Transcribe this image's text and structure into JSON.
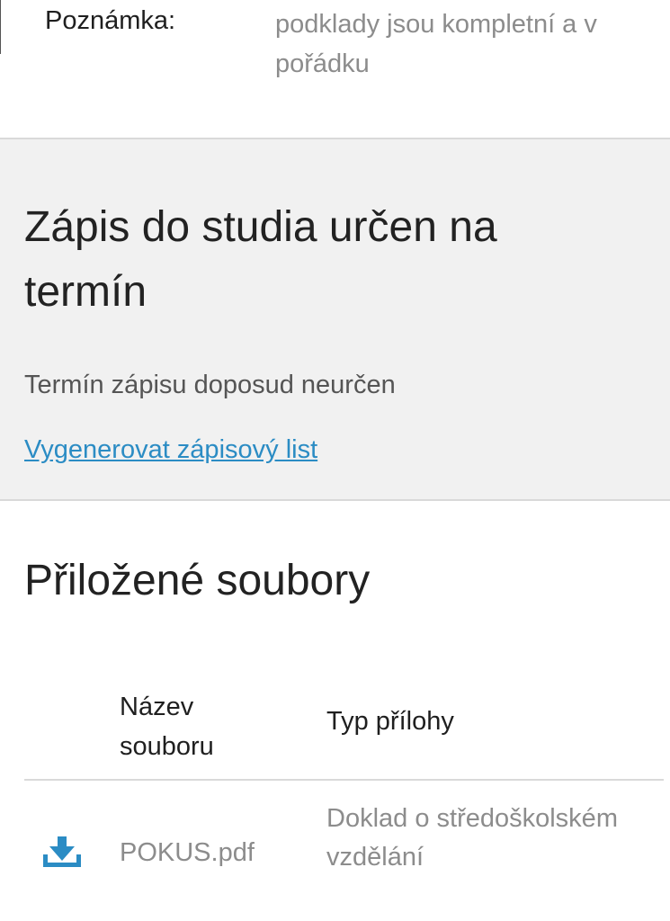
{
  "note": {
    "label": "Poznámka:",
    "value": "podklady jsou kompletní a v pořádku"
  },
  "enrollment": {
    "title": "Zápis do studia určen na termín",
    "status": "Termín zápisu doposud neurčen",
    "link_label": "Vygenerovat zápisový list"
  },
  "attachments": {
    "title": "Přiložené soubory",
    "columns": {
      "name": "Název souboru",
      "type": "Typ přílohy"
    },
    "rows": [
      {
        "icon": "download-icon",
        "file_name": "POKUS.pdf",
        "type": "Doklad o středoškolském vzdělání"
      }
    ]
  },
  "colors": {
    "accent": "#2b8cc4",
    "section_bg": "#f1f1f1"
  }
}
